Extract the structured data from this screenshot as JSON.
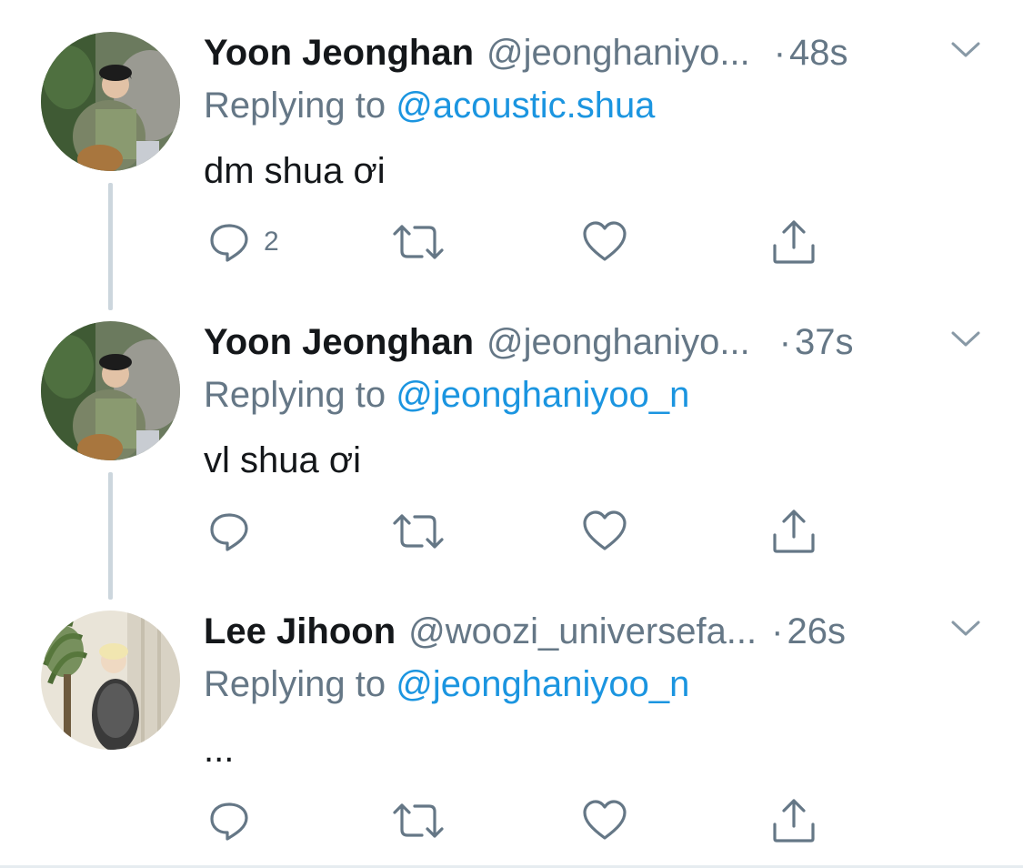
{
  "tweets": [
    {
      "name": "Yoon Jeonghan",
      "handle": "@jeonghaniyo...",
      "dot": "·",
      "time": "48s",
      "replying_prefix": "Replying to ",
      "replying_to": "@acoustic.shua",
      "text": "dm shua ơi",
      "reply_count": "2",
      "avatar": "jeonghan-avatar"
    },
    {
      "name": "Yoon Jeonghan",
      "handle": "@jeonghaniyo...",
      "dot": "·",
      "time": "37s",
      "replying_prefix": "Replying to ",
      "replying_to": "@jeonghaniyoo_n",
      "text": "vl shua ơi",
      "reply_count": "",
      "avatar": "jeonghan-avatar"
    },
    {
      "name": "Lee Jihoon",
      "handle": "@woozi_universefa...",
      "dot": "·",
      "time": "26s",
      "replying_prefix": "Replying to ",
      "replying_to": "@jeonghaniyoo_n",
      "text": "...",
      "reply_count": "",
      "avatar": "jihoon-avatar"
    }
  ],
  "icons": {
    "reply": "reply-icon",
    "retweet": "retweet-icon",
    "like": "heart-icon",
    "share": "share-icon",
    "more": "chevron-down-icon"
  },
  "colors": {
    "name": "#14171a",
    "secondary": "#657786",
    "mention": "#1b95e0",
    "thread_line": "#ccd6dd"
  }
}
